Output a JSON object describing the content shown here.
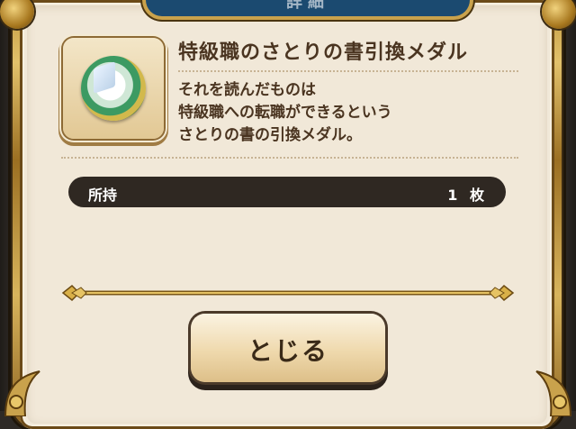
{
  "header": {
    "title": "詳細"
  },
  "item": {
    "icon": "medal-icon",
    "name": "特級職のさとりの書引換メダル",
    "description_lines": [
      "それを読んだものは",
      "特級職への転職ができるという",
      "さとりの書の引換メダル。"
    ]
  },
  "owned": {
    "label": "所持",
    "value": "1 枚"
  },
  "actions": {
    "close_label": "とじる"
  },
  "colors": {
    "panel_bg": "#f1e8d8",
    "frame_gold": "#c9a24c",
    "title_plate": "#1b4a70",
    "owned_bar_bg": "#2f2822",
    "text_brown": "#4a3420"
  }
}
